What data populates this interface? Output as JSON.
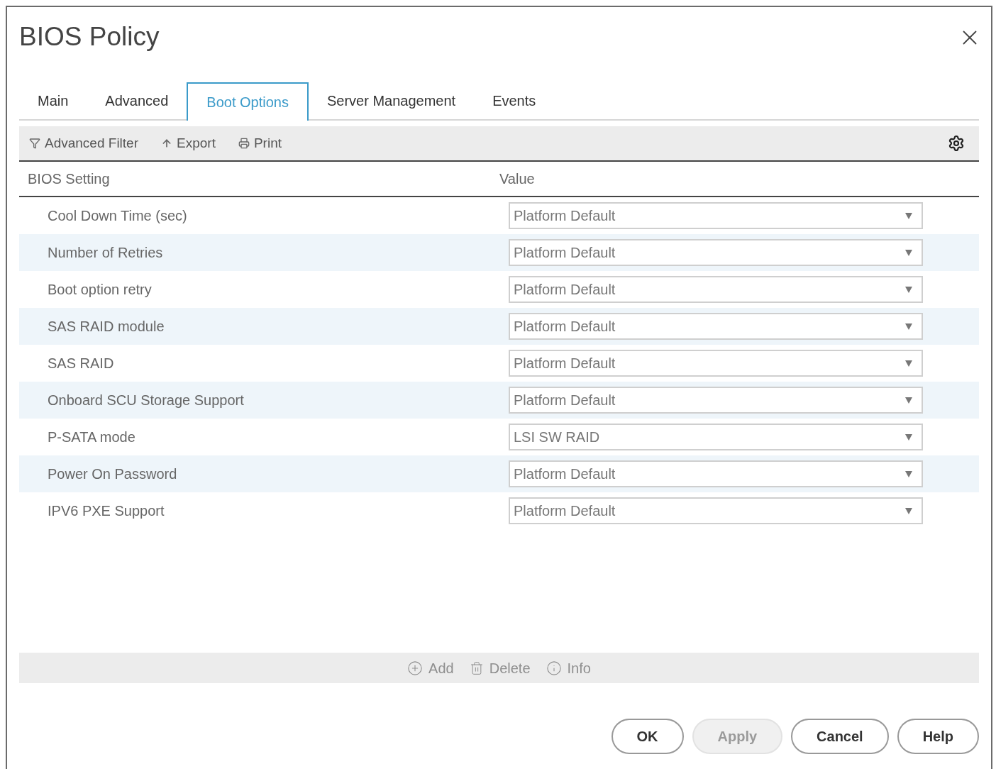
{
  "dialog": {
    "title": "BIOS Policy"
  },
  "tabs": [
    {
      "label": "Main",
      "selected": false
    },
    {
      "label": "Advanced",
      "selected": false
    },
    {
      "label": "Boot Options",
      "selected": true
    },
    {
      "label": "Server Management",
      "selected": false
    },
    {
      "label": "Events",
      "selected": false
    }
  ],
  "toolbar": [
    {
      "label": "Advanced Filter"
    },
    {
      "label": "Export"
    },
    {
      "label": "Print"
    }
  ],
  "table": {
    "columns": [
      "BIOS Setting",
      "Value"
    ],
    "rows": [
      {
        "setting": "Cool Down Time (sec)",
        "value": "Platform Default"
      },
      {
        "setting": "Number of Retries",
        "value": "Platform Default"
      },
      {
        "setting": "Boot option retry",
        "value": "Platform Default"
      },
      {
        "setting": "SAS RAID module",
        "value": "Platform Default"
      },
      {
        "setting": "SAS RAID",
        "value": "Platform Default"
      },
      {
        "setting": "Onboard SCU Storage Support",
        "value": "Platform Default"
      },
      {
        "setting": "P-SATA mode",
        "value": "LSI SW RAID"
      },
      {
        "setting": "Power On Password",
        "value": "Platform Default"
      },
      {
        "setting": "IPV6 PXE Support",
        "value": "Platform Default"
      }
    ]
  },
  "table_actions": [
    {
      "label": "Add",
      "disabled": true
    },
    {
      "label": "Delete",
      "disabled": true
    },
    {
      "label": "Info",
      "disabled": true
    }
  ],
  "buttons": [
    {
      "label": "OK",
      "disabled": false
    },
    {
      "label": "Apply",
      "disabled": true
    },
    {
      "label": "Cancel",
      "disabled": false
    },
    {
      "label": "Help",
      "disabled": false
    }
  ]
}
